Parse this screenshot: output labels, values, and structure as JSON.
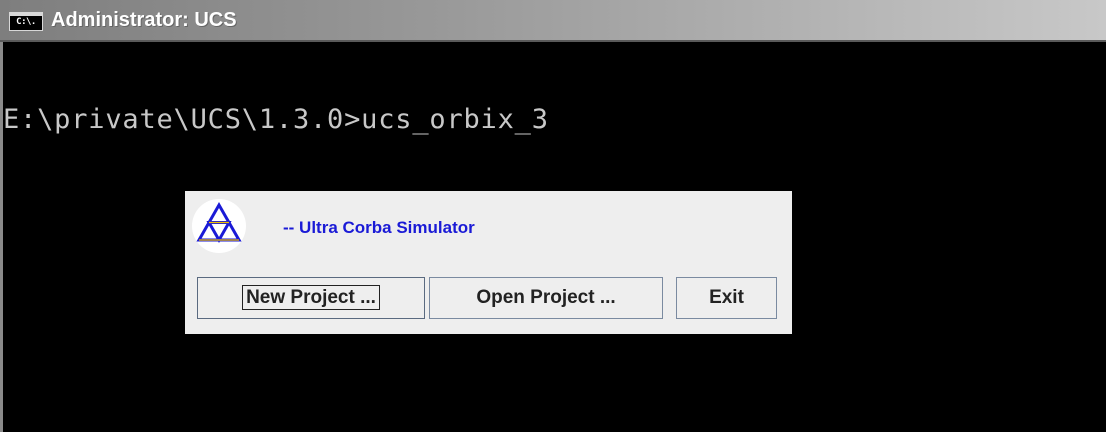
{
  "window": {
    "title": "Administrator: UCS",
    "icon_text": "C:\\."
  },
  "console": {
    "prompt_line": "E:\\private\\UCS\\1.3.0>ucs_orbix_3"
  },
  "dialog": {
    "app_title": "-- Ultra Corba Simulator",
    "logo_icon": "triangle-logo-icon",
    "buttons": {
      "new_project": "New Project ...",
      "open_project": "Open Project ...",
      "exit": "Exit"
    }
  },
  "colors": {
    "console_bg": "#000000",
    "console_text": "#c8c8c8",
    "app_title": "#1a1ad6",
    "logo_outline": "#1a1ad6",
    "logo_fill": "#f0c000",
    "dialog_bg": "#eeeeee"
  }
}
